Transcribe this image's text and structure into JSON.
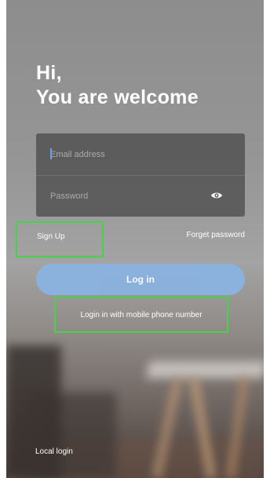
{
  "greeting": {
    "line1": "Hi,",
    "line2": "You are welcome"
  },
  "form": {
    "email_placeholder": "Email address",
    "password_placeholder": "Password",
    "password_toggle_icon": "eye-icon"
  },
  "links": {
    "sign_up": "Sign Up",
    "forget_password": "Forget password",
    "mobile_login": "Login in with mobile phone number",
    "local_login": "Local login"
  },
  "buttons": {
    "login": "Log in"
  },
  "colors": {
    "accent_button": "#8ab2e0",
    "highlight_border": "#48d24a",
    "caret": "#6aa1e8"
  }
}
